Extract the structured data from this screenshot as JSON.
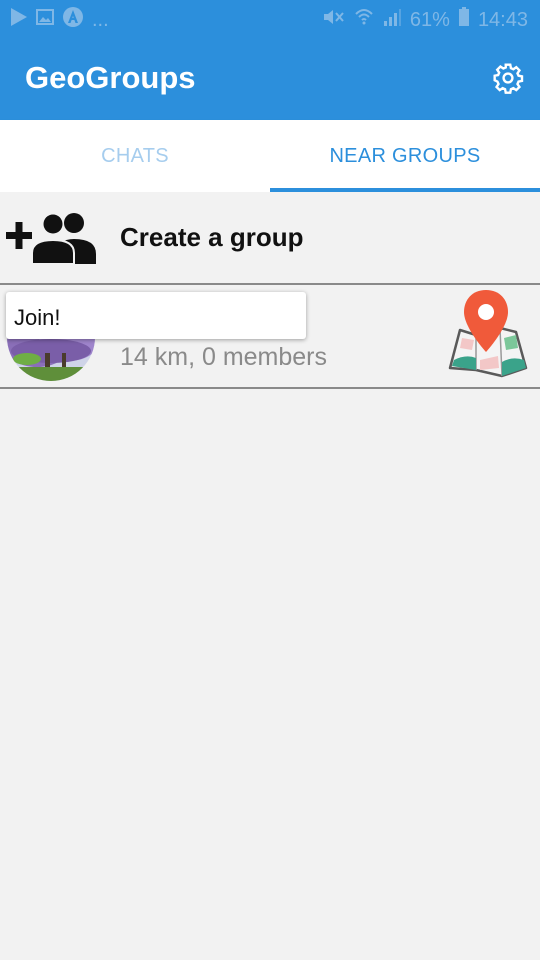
{
  "status_bar": {
    "left_icons": [
      "play-store-icon",
      "image-icon",
      "angular-icon"
    ],
    "overflow": "...",
    "mute_icon": "mute-icon",
    "wifi_icon": "wifi-icon",
    "signal_icon": "signal-icon",
    "battery_percent": "61%",
    "battery_icon": "battery-icon",
    "time": "14:43"
  },
  "app_bar": {
    "title": "GeoGroups",
    "settings_icon": "gear-icon",
    "color": "#2c8fdc"
  },
  "tabs": [
    {
      "label": "CHATS",
      "active": false
    },
    {
      "label": "NEAR GROUPS",
      "active": true
    }
  ],
  "create_group": {
    "icon": "add-group-icon",
    "label": "Create a group"
  },
  "groups": [
    {
      "avatar": "group-avatar",
      "meta": "14 km, 0 members",
      "map_icon": "map-pin-icon"
    }
  ],
  "tooltip": {
    "label": "Join!"
  }
}
